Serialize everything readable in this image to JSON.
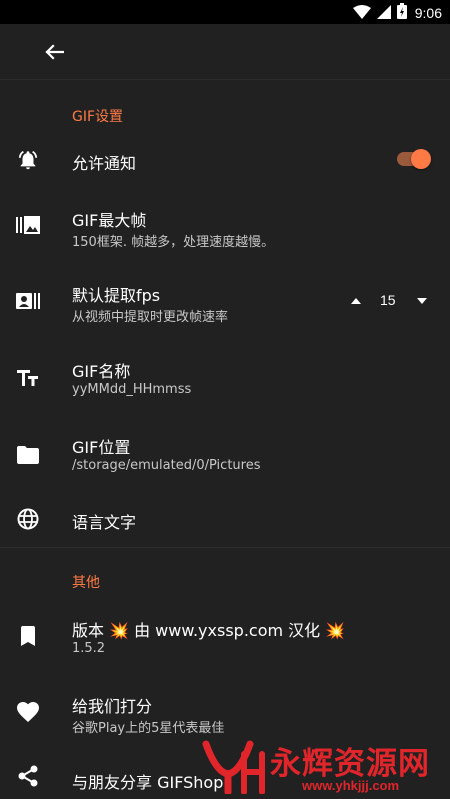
{
  "status_bar": {
    "time": "9:06",
    "icons": [
      "wifi-icon",
      "signal-icon",
      "battery-icon"
    ]
  },
  "app_bar": {
    "back_icon": "arrow-left-icon"
  },
  "accent_color": "#ff7a45",
  "sections": {
    "gif": {
      "header": "GIF设置"
    },
    "other": {
      "header": "其他"
    }
  },
  "settings": {
    "notifications": {
      "title": "允许通知",
      "icon": "bell-ring-icon",
      "enabled": true
    },
    "max_frames": {
      "title": "GIF最大帧",
      "subtitle": "150框架. 帧越多，处理速度越慢。",
      "icon": "image-library-icon"
    },
    "default_fps": {
      "title": "默认提取fps",
      "subtitle": "从视频中提取时更改帧速率",
      "icon": "contact-card-icon",
      "value": "15"
    },
    "gif_name": {
      "title": "GIF名称",
      "subtitle": "yyMMdd_HHmmss",
      "icon": "text-format-icon"
    },
    "gif_location": {
      "title": "GIF位置",
      "subtitle": "/storage/emulated/0/Pictures",
      "icon": "folder-icon"
    },
    "language": {
      "title": "语言文字",
      "icon": "globe-icon"
    }
  },
  "other": {
    "version": {
      "title": "版本 💥 由 www.yxssp.com 汉化 💥",
      "subtitle": "1.5.2",
      "icon": "bookmark-icon"
    },
    "rate": {
      "title": "给我们打分",
      "subtitle": "谷歌Play上的5星代表最佳",
      "icon": "heart-icon"
    },
    "share": {
      "title": "与朋友分享 GIFShop",
      "icon": "share-icon"
    }
  },
  "watermark": {
    "text": "永辉资源网",
    "url": "www.yhkjjj.com"
  }
}
